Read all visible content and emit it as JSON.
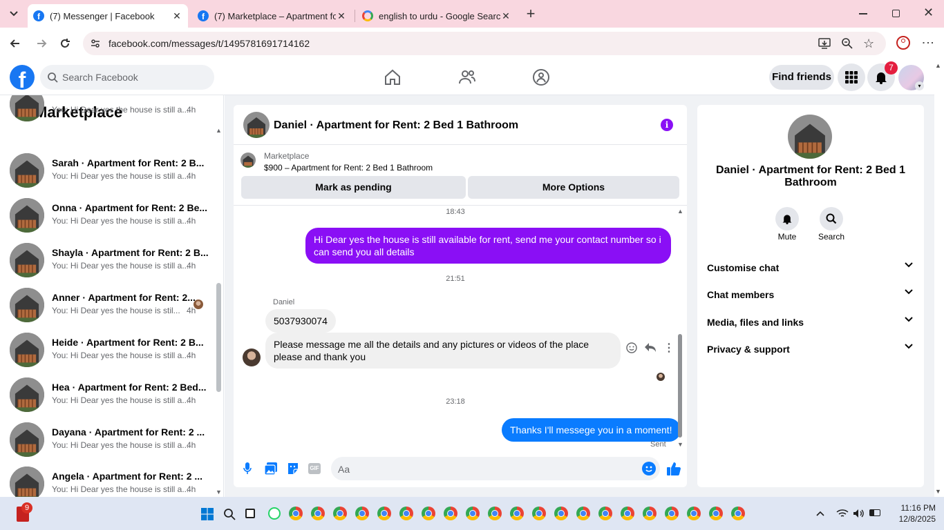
{
  "browser": {
    "tabs": [
      {
        "title": "(7) Messenger | Facebook",
        "active": true
      },
      {
        "title": "(7) Marketplace – Apartment fo",
        "active": false
      },
      {
        "title": "english to urdu - Google Search",
        "active": false
      }
    ],
    "url": "facebook.com/messages/t/1495781691714162"
  },
  "fb_header": {
    "search_placeholder": "Search Facebook",
    "find_friends": "Find friends",
    "notification_count": "7"
  },
  "sidebar": {
    "title": "Marketplace",
    "conversations": [
      {
        "name": "",
        "preview": "You: Hi Dear yes the house is still a...",
        "time": "4h"
      },
      {
        "name": "Sarah · Apartment for Rent: 2 B...",
        "preview": "You: Hi Dear yes the house is still a...",
        "time": "4h"
      },
      {
        "name": "Onna · Apartment for Rent: 2 Be...",
        "preview": "You: Hi Dear yes the house is still a...",
        "time": "4h"
      },
      {
        "name": "Shayla · Apartment for Rent: 2 B...",
        "preview": "You: Hi Dear yes the house is still a...",
        "time": "4h"
      },
      {
        "name": "Anner · Apartment for Rent: 2...",
        "preview": "You: Hi Dear yes the house is stil...",
        "time": "4h"
      },
      {
        "name": "Heide · Apartment for Rent: 2 B...",
        "preview": "You: Hi Dear yes the house is still a...",
        "time": "4h"
      },
      {
        "name": "Hea · Apartment for Rent: 2 Bed...",
        "preview": "You: Hi Dear yes the house is still a...",
        "time": "4h"
      },
      {
        "name": "Dayana · Apartment for Rent: 2 ...",
        "preview": "You: Hi Dear yes the house is still a...",
        "time": "4h"
      },
      {
        "name": "Angela · Apartment for Rent: 2 ...",
        "preview": "You: Hi Dear yes the house is still a...",
        "time": "4h"
      }
    ]
  },
  "chat": {
    "title": "Daniel · Apartment for Rent: 2 Bed 1 Bathroom",
    "listing": {
      "source": "Marketplace",
      "price_title": "$900 – Apartment for Rent: 2 Bed 1 Bathroom"
    },
    "buttons": {
      "pending": "Mark as pending",
      "more": "More Options"
    },
    "time1": "18:43",
    "msg_out1": "Hi Dear yes the house is still available for rent, send me your contact number so i can send you all details",
    "time2": "21:51",
    "sender_name": "Daniel",
    "msg_in1": "5037930074",
    "msg_in2": "Please message me all the details and any pictures or videos of the place please and thank you",
    "time3": "23:18",
    "msg_out2": "Thanks I'll messege you in a moment!",
    "sent_status": "Sent",
    "composer_placeholder": "Aa"
  },
  "info_panel": {
    "title": "Daniel · Apartment for Rent: 2 Bed 1 Bathroom",
    "mute": "Mute",
    "search": "Search",
    "sections": [
      "Customise chat",
      "Chat members",
      "Media, files and links",
      "Privacy & support"
    ]
  },
  "taskbar": {
    "time": "11:16 PM",
    "date": "12/8/2025",
    "app_badge": "9"
  },
  "colors": {
    "fb_blue": "#1877f2",
    "outgoing_purple": "#8a0ff5",
    "outgoing_blue": "#0a7cff",
    "tabstrip_pink": "#f9d7e0"
  }
}
